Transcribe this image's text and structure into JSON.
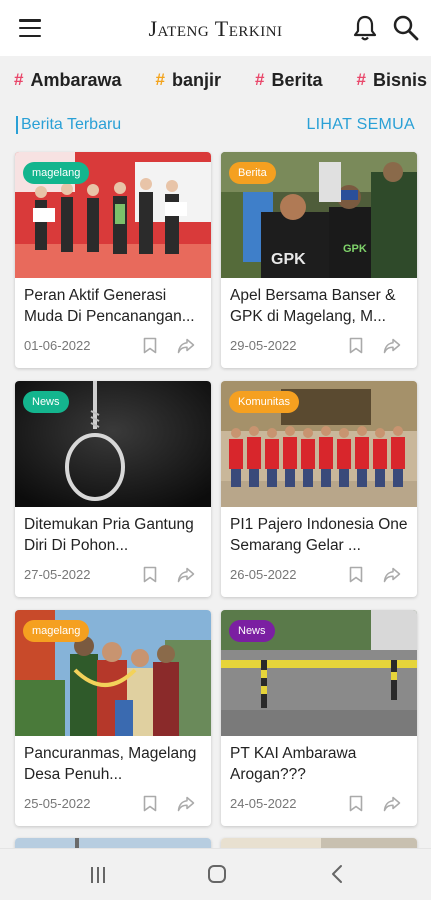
{
  "app_title": "Jateng Terkini",
  "tags": [
    {
      "label": "Ambarawa",
      "hash": "#",
      "color": "#e9476a"
    },
    {
      "label": "banjir",
      "hash": "#",
      "color": "#f3a31b"
    },
    {
      "label": "Berita",
      "hash": "#",
      "color": "#e9476a"
    },
    {
      "label": "Bisnis",
      "hash": "#",
      "color": "#e9476a"
    }
  ],
  "section": {
    "title": "Berita Terbaru",
    "see_all": "LIHAT SEMUA"
  },
  "colors": {
    "accent": "#2aa0d6",
    "badge_magelang": "#f5a020",
    "badge_berita": "#f5a020",
    "badge_news_teal": "#14b58e",
    "badge_news_purple": "#7b1fa2",
    "badge_komunitas": "#f5a020"
  },
  "articles": [
    {
      "badge": "magelang",
      "badge_color": "#14b58e",
      "title": "Peran Aktif Generasi Muda Di Pencanangan...",
      "date": "01-06-2022"
    },
    {
      "badge": "Berita",
      "badge_color": "#f5a020",
      "title": "Apel Bersama Banser & GPK di Magelang, M...",
      "date": "29-05-2022"
    },
    {
      "badge": "News",
      "badge_color": "#14b58e",
      "title": "Ditemukan Pria Gantung Diri Di Pohon...",
      "date": "27-05-2022"
    },
    {
      "badge": "Komunitas",
      "badge_color": "#f5a020",
      "title": "PI1 Pajero Indonesia One Semarang Gelar ...",
      "date": "26-05-2022"
    },
    {
      "badge": "magelang",
      "badge_color": "#f5a020",
      "title": "Pancuranmas, Magelang Desa Penuh...",
      "date": "25-05-2022"
    },
    {
      "badge": "News",
      "badge_color": "#7b1fa2",
      "title": "PT KAI Ambarawa Arogan???",
      "date": "24-05-2022"
    }
  ],
  "icons": {
    "menu": "menu-icon",
    "bell": "bell-icon",
    "search": "search-icon",
    "bookmark": "bookmark-icon",
    "share": "share-icon",
    "recent": "recent-apps-icon",
    "home": "home-icon",
    "back": "back-icon"
  }
}
